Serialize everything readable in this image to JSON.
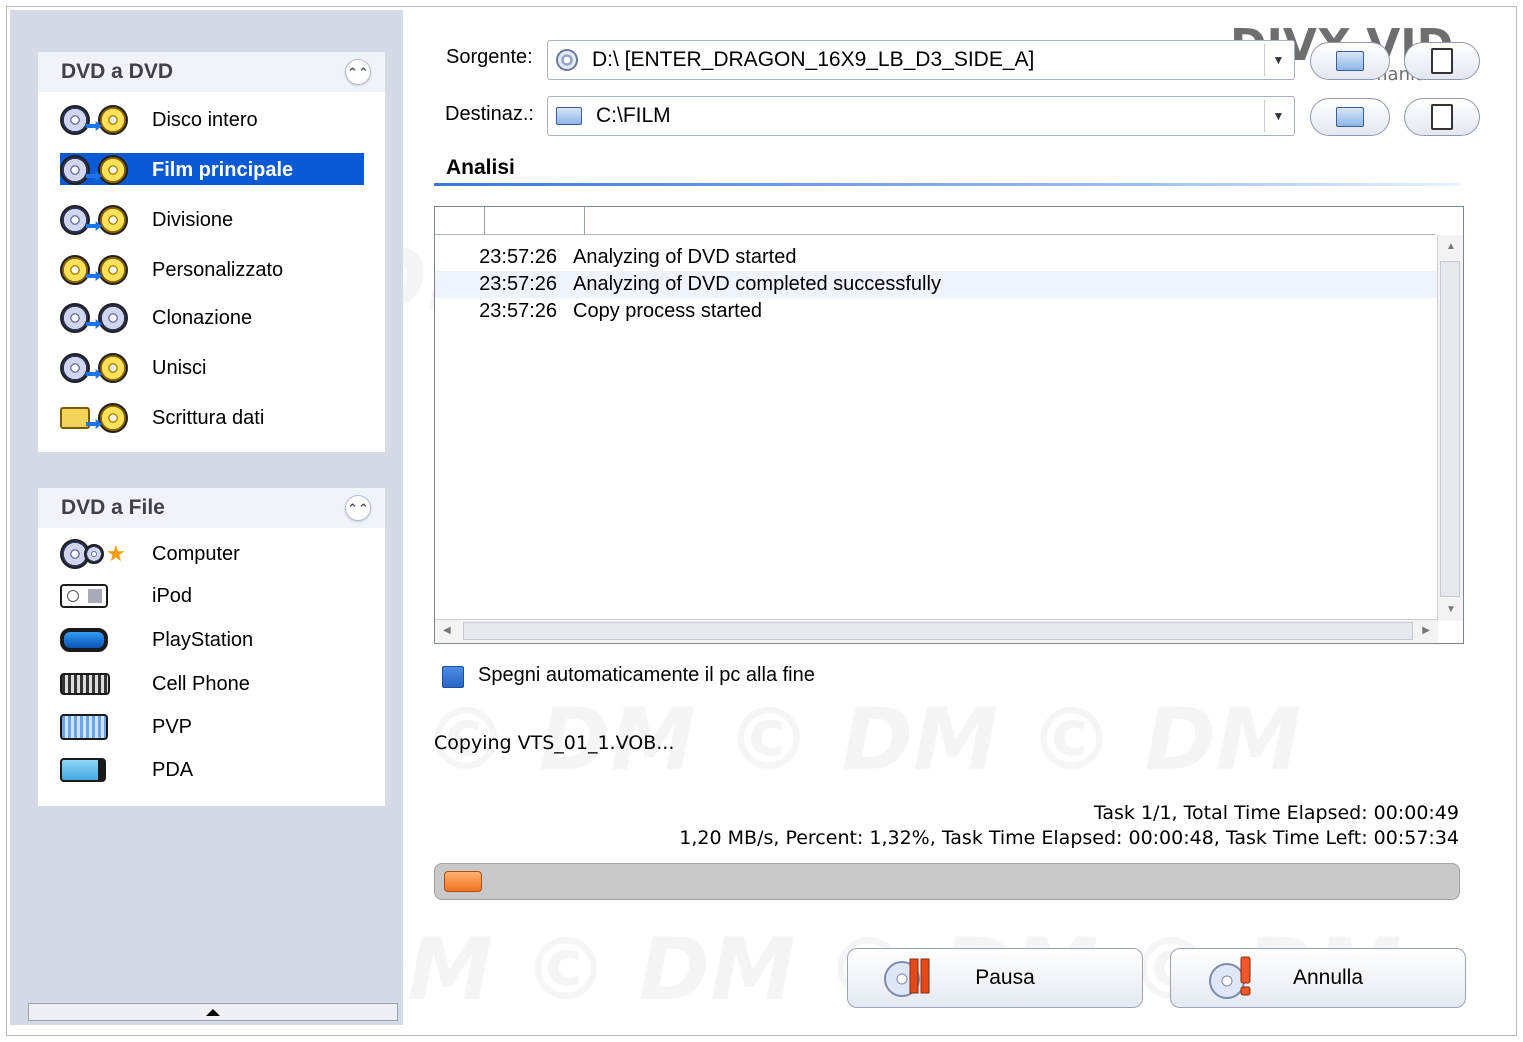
{
  "sidebar": {
    "dvd_to_dvd": {
      "title": "DVD a DVD",
      "items": [
        {
          "label": "Disco intero",
          "icon": "disc-to-disc-icon"
        },
        {
          "label": "Film principale",
          "icon": "main-movie-icon",
          "selected": true
        },
        {
          "label": "Divisione",
          "icon": "split-icon"
        },
        {
          "label": "Personalizzato",
          "icon": "custom-icon"
        },
        {
          "label": "Clonazione",
          "icon": "clone-icon"
        },
        {
          "label": "Unisci",
          "icon": "merge-icon"
        },
        {
          "label": "Scrittura dati",
          "icon": "write-data-icon"
        }
      ]
    },
    "dvd_to_file": {
      "title": "DVD a File",
      "items": [
        {
          "label": "Computer",
          "icon": "computer-icon"
        },
        {
          "label": "iPod",
          "icon": "ipod-icon"
        },
        {
          "label": "PlayStation",
          "icon": "psp-icon"
        },
        {
          "label": "Cell Phone",
          "icon": "cell-phone-icon"
        },
        {
          "label": "PVP",
          "icon": "pvp-icon"
        },
        {
          "label": "PDA",
          "icon": "pda-icon"
        }
      ]
    }
  },
  "source": {
    "label": "Sorgente:",
    "value": "D:\\ [ENTER_DRAGON_16X9_LB_D3_SIDE_A]"
  },
  "destination": {
    "label": "Destinaz.:",
    "value": "C:\\FILM"
  },
  "section": {
    "title": "Analisi"
  },
  "log": [
    {
      "time": "23:57:26",
      "message": "Analyzing of DVD started"
    },
    {
      "time": "23:57:26",
      "message": "Analyzing of DVD completed successfully"
    },
    {
      "time": "23:57:26",
      "message": "Copy process started"
    }
  ],
  "shutdown_checkbox": {
    "label": "Spegni automaticamente il pc alla fine"
  },
  "status": {
    "current_file": "Copying VTS_01_1.VOB...",
    "line1": "Task 1/1,  Total Time Elapsed: 00:00:49",
    "line2": "1,20 MB/s,  Percent: 1,32%,  Task Time Elapsed: 00:00:48,  Task Time Left: 00:57:34",
    "progress_percent": 1.32
  },
  "buttons": {
    "pause": "Pausa",
    "cancel": "Annulla"
  },
  "logo": {
    "text": "DIVX VID",
    "sub": "mania.it"
  },
  "watermark": "© DM © DM © DM © DM"
}
